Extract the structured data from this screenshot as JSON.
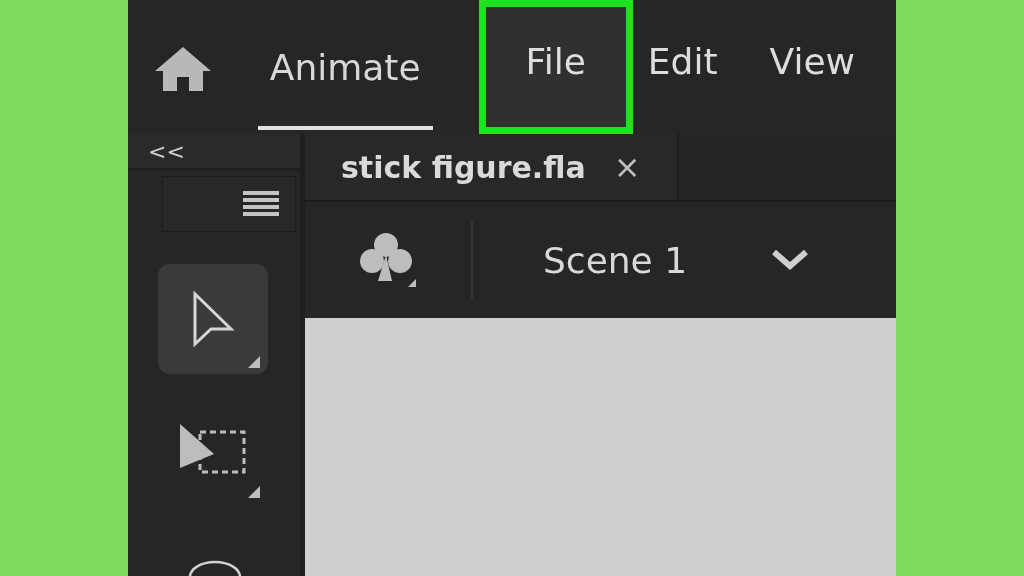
{
  "menu_bar": {
    "app_tab": {
      "label": "Animate",
      "selected": true
    },
    "menus": [
      {
        "label": "File",
        "highlighted": true
      },
      {
        "label": "Edit",
        "highlighted": false
      },
      {
        "label": "View",
        "highlighted": false
      }
    ]
  },
  "tools_panel": {
    "collapse": "<<",
    "tools": [
      {
        "kind": "select",
        "selected": true
      },
      {
        "kind": "subselect",
        "selected": false
      },
      {
        "kind": "lasso",
        "selected": false
      }
    ]
  },
  "document_tabs": [
    {
      "label": "stick figure.fla",
      "close": "×"
    }
  ],
  "scene_bar": {
    "scene": "Scene 1"
  }
}
